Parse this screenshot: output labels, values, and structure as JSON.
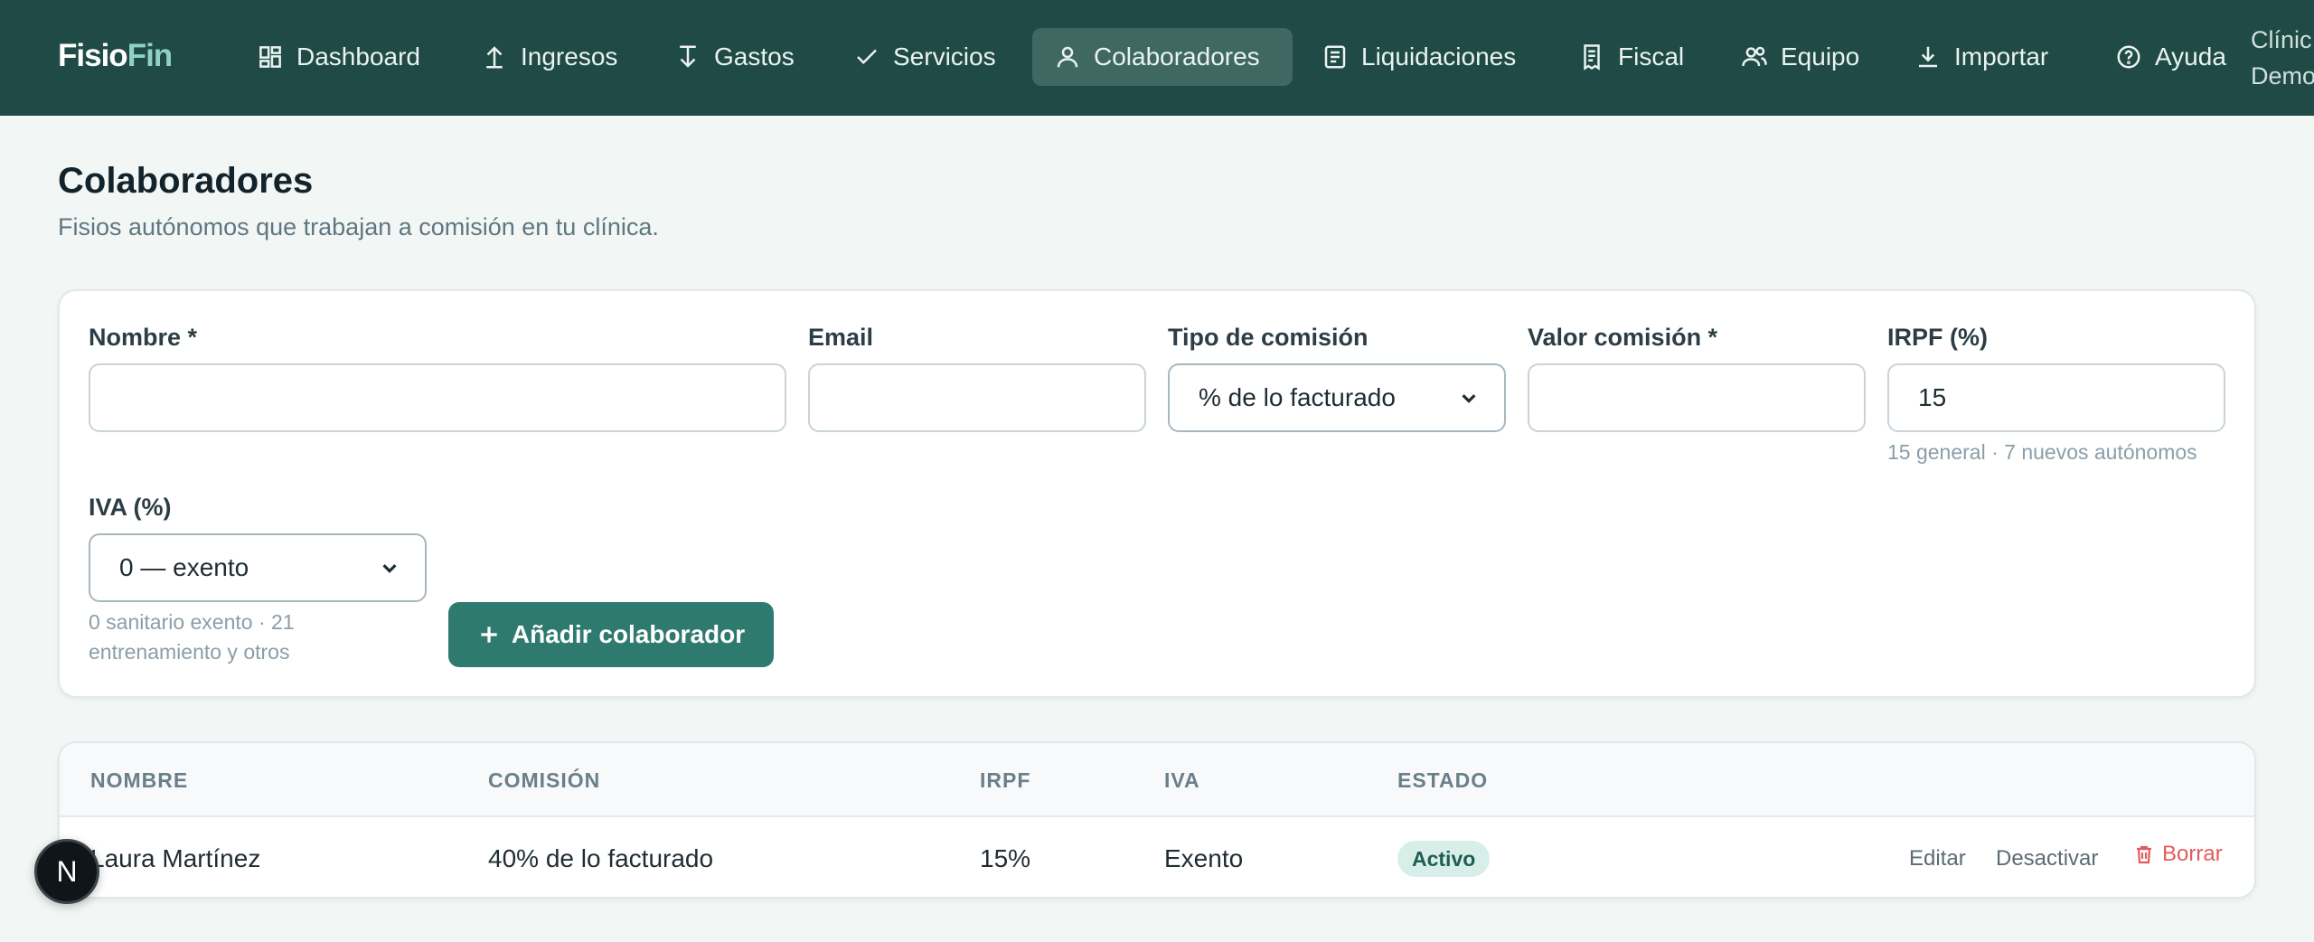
{
  "app": {
    "logo_part1": "Fisio",
    "logo_part2": "Fin",
    "clinic_line1": "Clínic",
    "clinic_line2": "Demo"
  },
  "nav": {
    "items": [
      {
        "label": "Dashboard",
        "icon": "dashboard-icon"
      },
      {
        "label": "Ingresos",
        "icon": "arrow-up-icon"
      },
      {
        "label": "Gastos",
        "icon": "arrow-down-icon"
      },
      {
        "label": "Servicios",
        "icon": "check-icon"
      },
      {
        "label": "Colaboradores",
        "icon": "user-icon",
        "active": true
      },
      {
        "label": "Liquidaciones",
        "icon": "document-icon"
      },
      {
        "label": "Fiscal",
        "icon": "receipt-icon"
      },
      {
        "label": "Equipo",
        "icon": "users-icon"
      },
      {
        "label": "Importar",
        "icon": "download-icon"
      },
      {
        "label": "Ayuda",
        "icon": "help-icon"
      }
    ]
  },
  "page": {
    "title": "Colaboradores",
    "subtitle": "Fisios autónomos que trabajan a comisión en tu clínica."
  },
  "form": {
    "nombre_label": "Nombre *",
    "nombre_value": "",
    "email_label": "Email",
    "email_value": "",
    "tipo_label": "Tipo de comisión",
    "tipo_value": "% de lo facturado",
    "valor_label": "Valor comisión *",
    "valor_value": "",
    "irpf_label": "IRPF (%)",
    "irpf_value": "15",
    "irpf_hint": "15 general · 7 nuevos autónomos",
    "iva_label": "IVA (%)",
    "iva_value": "0 — exento",
    "iva_hint_line1": "0 sanitario exento · 21",
    "iva_hint_line2": "entrenamiento y otros",
    "add_button": "Añadir colaborador"
  },
  "table": {
    "headers": [
      "NOMBRE",
      "COMISIÓN",
      "IRPF",
      "IVA",
      "ESTADO"
    ],
    "rows": [
      {
        "nombre": "Laura Martínez",
        "comision": "40% de lo facturado",
        "irpf": "15%",
        "iva": "Exento",
        "estado": "Activo",
        "edit": "Editar",
        "deactivate": "Desactivar",
        "delete": "Borrar"
      }
    ]
  },
  "fab": {
    "label": "N"
  },
  "colors": {
    "topbar": "#1f4a45",
    "primary": "#2e7a6e",
    "danger": "#e45b5b",
    "badge_bg": "#d8efe9"
  }
}
